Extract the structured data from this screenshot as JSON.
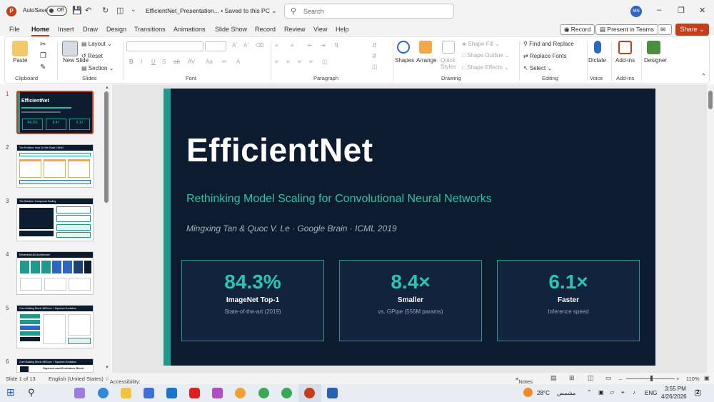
{
  "titlebar": {
    "autosave_label": "AutoSave",
    "autosave_state": "Off",
    "doc_title": "EfficientNet_Presentation... • Saved to this PC ⌄",
    "search_placeholder": "Search",
    "avatar": "MN"
  },
  "menu": {
    "items": [
      "File",
      "Home",
      "Insert",
      "Draw",
      "Design",
      "Transitions",
      "Animations",
      "Slide Show",
      "Record",
      "Review",
      "View",
      "Help"
    ],
    "active": "Home",
    "record": "Record",
    "present": "Present in Teams",
    "share": "Share"
  },
  "ribbon": {
    "clipboard": {
      "paste": "Paste",
      "group": "Clipboard"
    },
    "slides": {
      "new_slide": "New Slide",
      "layout": "Layout",
      "reset": "Reset",
      "section": "Section",
      "group": "Slides"
    },
    "font": {
      "group": "Font"
    },
    "paragraph": {
      "group": "Paragraph"
    },
    "drawing": {
      "shapes": "Shapes",
      "arrange": "Arrange",
      "quick_styles": "Quick Styles",
      "shape_fill": "Shape Fill",
      "shape_outline": "Shape Outline",
      "shape_effects": "Shape Effects",
      "group": "Drawing"
    },
    "editing": {
      "find": "Find and Replace",
      "replace_fonts": "Replace Fonts",
      "select": "Select",
      "group": "Editing"
    },
    "voice": {
      "dictate": "Dictate",
      "group": "Voice"
    },
    "addins": {
      "addins": "Add-ins",
      "group": "Add-ins"
    },
    "designer": {
      "designer": "Designer"
    }
  },
  "thumbnails": {
    "numbers": [
      "1",
      "2",
      "3",
      "4",
      "5",
      "6"
    ],
    "t1": {
      "title": "EfficientNet",
      "stats": [
        "84.3%",
        "8.4×",
        "6.1×"
      ]
    },
    "t2": {
      "title": "The Problem: How Do We Scale CNNs?"
    },
    "t3": {
      "title": "The Solution: Compound Scaling"
    },
    "t4": {
      "title": "EfficientNet-B0 Architecture"
    },
    "t5": {
      "title": "Core Building Block: MBConv + Squeeze-Excitation"
    },
    "t6": {
      "title": "Core Building Block: MBConv + Squeeze-Excitation",
      "subtitle": "Squeeze-and-Excitation Block"
    }
  },
  "slide": {
    "title": "EfficientNet",
    "subtitle": "Rethinking Model Scaling for Convolutional Neural Networks",
    "authors": "Mingxing Tan & Quoc V. Le  ·  Google Brain  ·  ICML 2019",
    "cards": [
      {
        "value": "84.3%",
        "label": "ImageNet Top-1",
        "desc": "State-of-the-art (2019)"
      },
      {
        "value": "8.4×",
        "label": "Smaller",
        "desc": "vs. GPipe (556M params)"
      },
      {
        "value": "6.1×",
        "label": "Faster",
        "desc": "Inference speed"
      }
    ]
  },
  "statusbar": {
    "slide_count": "Slide 1 of 13",
    "language": "English (United States)",
    "accessibility": "Accessibility: Good to go",
    "notes": "Notes",
    "zoom": "110%"
  },
  "taskbar": {
    "temp": "28°C",
    "weather": "مشمس",
    "lang": "ENG",
    "time": "3:55 PM",
    "date": "4/26/2026",
    "badge": "2"
  }
}
